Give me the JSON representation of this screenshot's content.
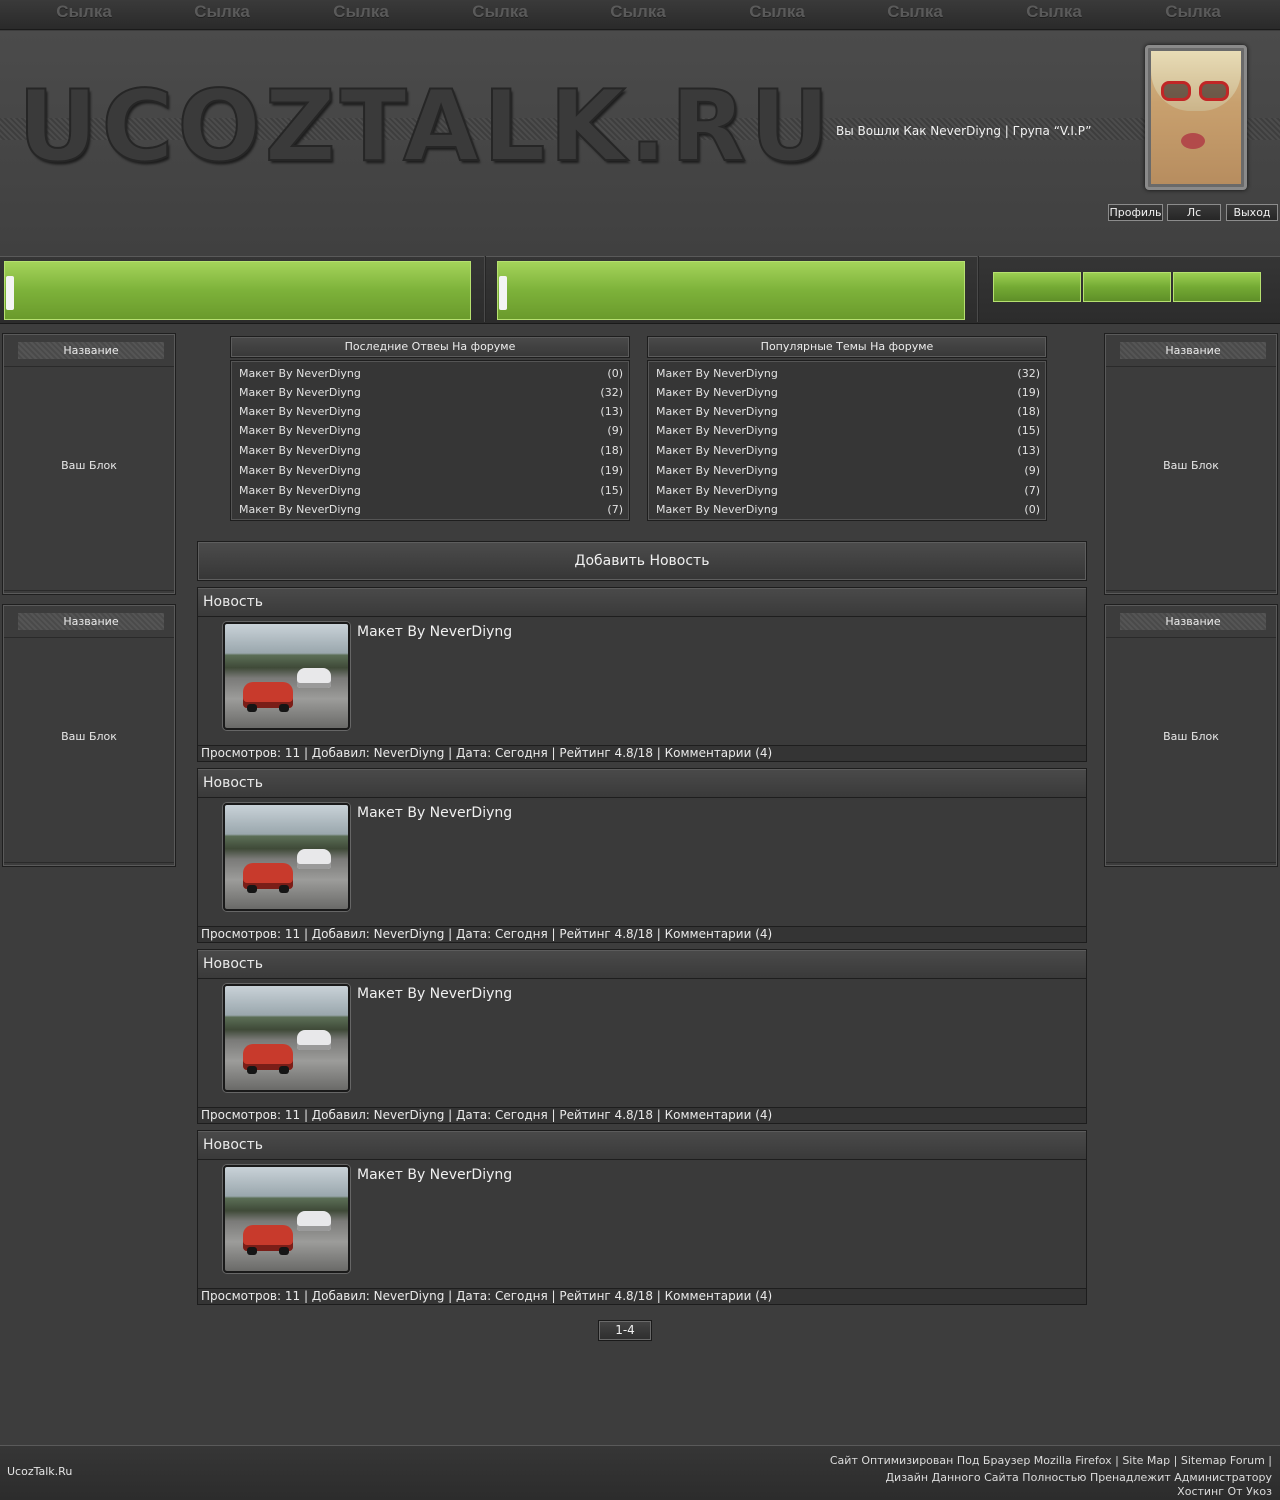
{
  "nav": {
    "links": [
      "Сылка",
      "Сылка",
      "Сылка",
      "Сылка",
      "Сылка",
      "Сылка",
      "Сылка",
      "Сылка",
      "Сылка"
    ]
  },
  "header": {
    "logo": "UCOZTALK.RU",
    "login_text": "Вы Вошли Как NeverDiyng | Група “V.I.P”",
    "buttons": {
      "profile": "Профиль",
      "pm": "Лс",
      "logout": "Выход"
    }
  },
  "left_blocks": [
    {
      "title": "Название",
      "body": "Ваш Блок"
    },
    {
      "title": "Название",
      "body": "Ваш Блок"
    }
  ],
  "right_blocks": [
    {
      "title": "Название",
      "body": "Ваш Блок"
    },
    {
      "title": "Название",
      "body": "Ваш Блок"
    }
  ],
  "forum": {
    "recent": {
      "title": "Последние Отвеы На форуме",
      "rows": [
        {
          "topic": "Макет By NeverDiyng",
          "count": "(0)"
        },
        {
          "topic": "Макет By NeverDiyng",
          "count": "(32)"
        },
        {
          "topic": "Макет By NeverDiyng",
          "count": "(13)"
        },
        {
          "topic": "Макет By NeverDiyng",
          "count": "(9)"
        },
        {
          "topic": "Макет By NeverDiyng",
          "count": "(18)"
        },
        {
          "topic": "Макет By NeverDiyng",
          "count": "(19)"
        },
        {
          "topic": "Макет By NeverDiyng",
          "count": "(15)"
        },
        {
          "topic": "Макет By NeverDiyng",
          "count": "(7)"
        }
      ]
    },
    "popular": {
      "title": "Популярные Темы На форуме",
      "rows": [
        {
          "topic": "Макет By NeverDiyng",
          "count": "(32)"
        },
        {
          "topic": "Макет By NeverDiyng",
          "count": "(19)"
        },
        {
          "topic": "Макет By NeverDiyng",
          "count": "(18)"
        },
        {
          "topic": "Макет By NeverDiyng",
          "count": "(15)"
        },
        {
          "topic": "Макет By NeverDiyng",
          "count": "(13)"
        },
        {
          "topic": "Макет By NeverDiyng",
          "count": "(9)"
        },
        {
          "topic": "Макет By NeverDiyng",
          "count": "(7)"
        },
        {
          "topic": "Макет By NeverDiyng",
          "count": "(0)"
        }
      ]
    }
  },
  "main": {
    "add_news": "Добавить Новость",
    "news": [
      {
        "header": "Новость",
        "title": "Макет By NeverDiyng",
        "footer": "Просмотров: 11 | Добавил: NeverDiyng | Дата: Сегодня | Рейтинг 4.8/18 | Комментарии (4)"
      },
      {
        "header": "Новость",
        "title": "Макет By NeverDiyng",
        "footer": "Просмотров: 11 | Добавил: NeverDiyng | Дата: Сегодня | Рейтинг 4.8/18 | Комментарии (4)"
      },
      {
        "header": "Новость",
        "title": "Макет By NeverDiyng",
        "footer": "Просмотров: 11 | Добавил: NeverDiyng | Дата: Сегодня | Рейтинг 4.8/18 | Комментарии (4)"
      },
      {
        "header": "Новость",
        "title": "Макет By NeverDiyng",
        "footer": "Просмотров: 11 | Добавил: NeverDiyng | Дата: Сегодня | Рейтинг 4.8/18 | Комментарии (4)"
      }
    ],
    "pager": "1-4"
  },
  "footer": {
    "site_name": "UcozTalk.Ru",
    "line1_text": "Сайт Оптимизирован Под Браузер Mozilla Firefox ",
    "sitemap": "Site Map",
    "sitemap_forum": "Sitemap Forum",
    "line2": "Дизайн Данного Сайта Полностью Пренадлежит Администратору",
    "line3": "Хостинг От Укоз"
  },
  "colors": {
    "accent_green": "#7db23a",
    "background": "#3d3d3d"
  }
}
